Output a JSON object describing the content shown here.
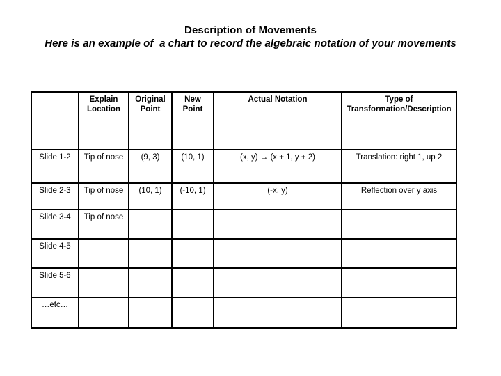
{
  "title": {
    "line1": "Description of Movements",
    "line2": "Here is an example of  a chart to record the algebraic notation of your movements"
  },
  "table": {
    "headers": [
      "",
      "Explain Location",
      "Original Point",
      "New Point",
      "Actual Notation",
      "Type of Transformation/Description"
    ],
    "rows": [
      {
        "slide": "Slide 1-2",
        "explain": "Tip of nose",
        "original_point": "(9, 3)",
        "new_point": "(10, 1)",
        "notation": "(x, y) → (x + 1, y + 2)",
        "type": "Translation: right 1, up 2"
      },
      {
        "slide": "Slide 2-3",
        "explain": "Tip of nose",
        "original_point": "(10, 1)",
        "new_point": "(-10, 1)",
        "notation": "(-x, y)",
        "type": "Reflection over y axis"
      },
      {
        "slide": "Slide 3-4",
        "explain": "Tip of nose",
        "original_point": "",
        "new_point": "",
        "notation": "",
        "type": ""
      },
      {
        "slide": "Slide 4-5",
        "explain": "",
        "original_point": "",
        "new_point": "",
        "notation": "",
        "type": ""
      },
      {
        "slide": "Slide 5-6",
        "explain": "",
        "original_point": "",
        "new_point": "",
        "notation": "",
        "type": ""
      },
      {
        "slide": "…etc…",
        "explain": "",
        "original_point": "",
        "new_point": "",
        "notation": "",
        "type": ""
      }
    ]
  },
  "colors": {
    "background": "#ffffff",
    "text": "#000000",
    "border": "#000000"
  }
}
